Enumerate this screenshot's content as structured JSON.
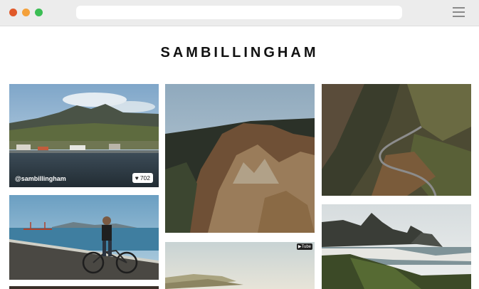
{
  "page": {
    "title": "SAMBILLINGHAM"
  },
  "photos": {
    "harbor": {
      "handle": "@sambillingham",
      "likes": "702"
    },
    "video": {
      "badge": "▶Tube"
    }
  }
}
